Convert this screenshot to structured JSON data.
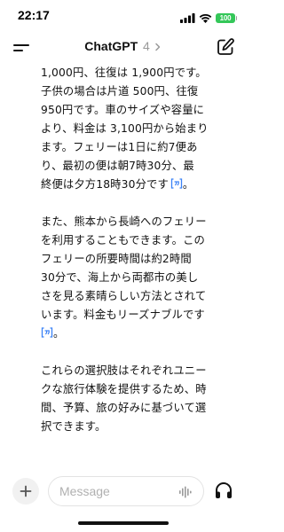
{
  "status_bar": {
    "time": "22:17",
    "battery": "100",
    "battery_color": "#34c759"
  },
  "nav": {
    "title": "ChatGPT",
    "version": "4",
    "menu_icon": "hamburger-menu-icon",
    "compose_icon": "compose-edit-icon",
    "chevron_icon": "chevron-right-icon"
  },
  "chat": {
    "paragraphs": [
      {
        "lines": [
          "1,000円、往復は 1,900円です。",
          "子供の場合は片道 500円、往復",
          "950円です。車のサイズや容量に",
          "より、料金は 3,100円から始まり",
          "ます。フェリーは1日に約7便あ",
          "り、最初の便は朝7時30分、最",
          "終便は夕方18時30分です"
        ],
        "citation": true
      },
      {
        "lines": [
          "また、熊本から長崎へのフェリー",
          "を利用することもできます。この",
          "フェリーの所要時間は約2時間",
          "30分で、海上から両都市の美し",
          "さを見る素晴らしい方法とされて",
          "います。料金もリーズナブルです"
        ],
        "citation": true
      },
      {
        "lines": [
          "これらの選択肢はそれぞれユニー",
          "クな旅行体験を提供するため、時",
          "間、予算、旅の好みに基づいて選",
          "択できます。"
        ],
        "citation": false
      }
    ],
    "citation_color": "#3b82f6"
  },
  "input_bar": {
    "placeholder": "Message",
    "value": "",
    "plus_icon": "plus-icon",
    "voice_icon": "voice-waveform-icon",
    "headphones_icon": "headphones-icon"
  }
}
